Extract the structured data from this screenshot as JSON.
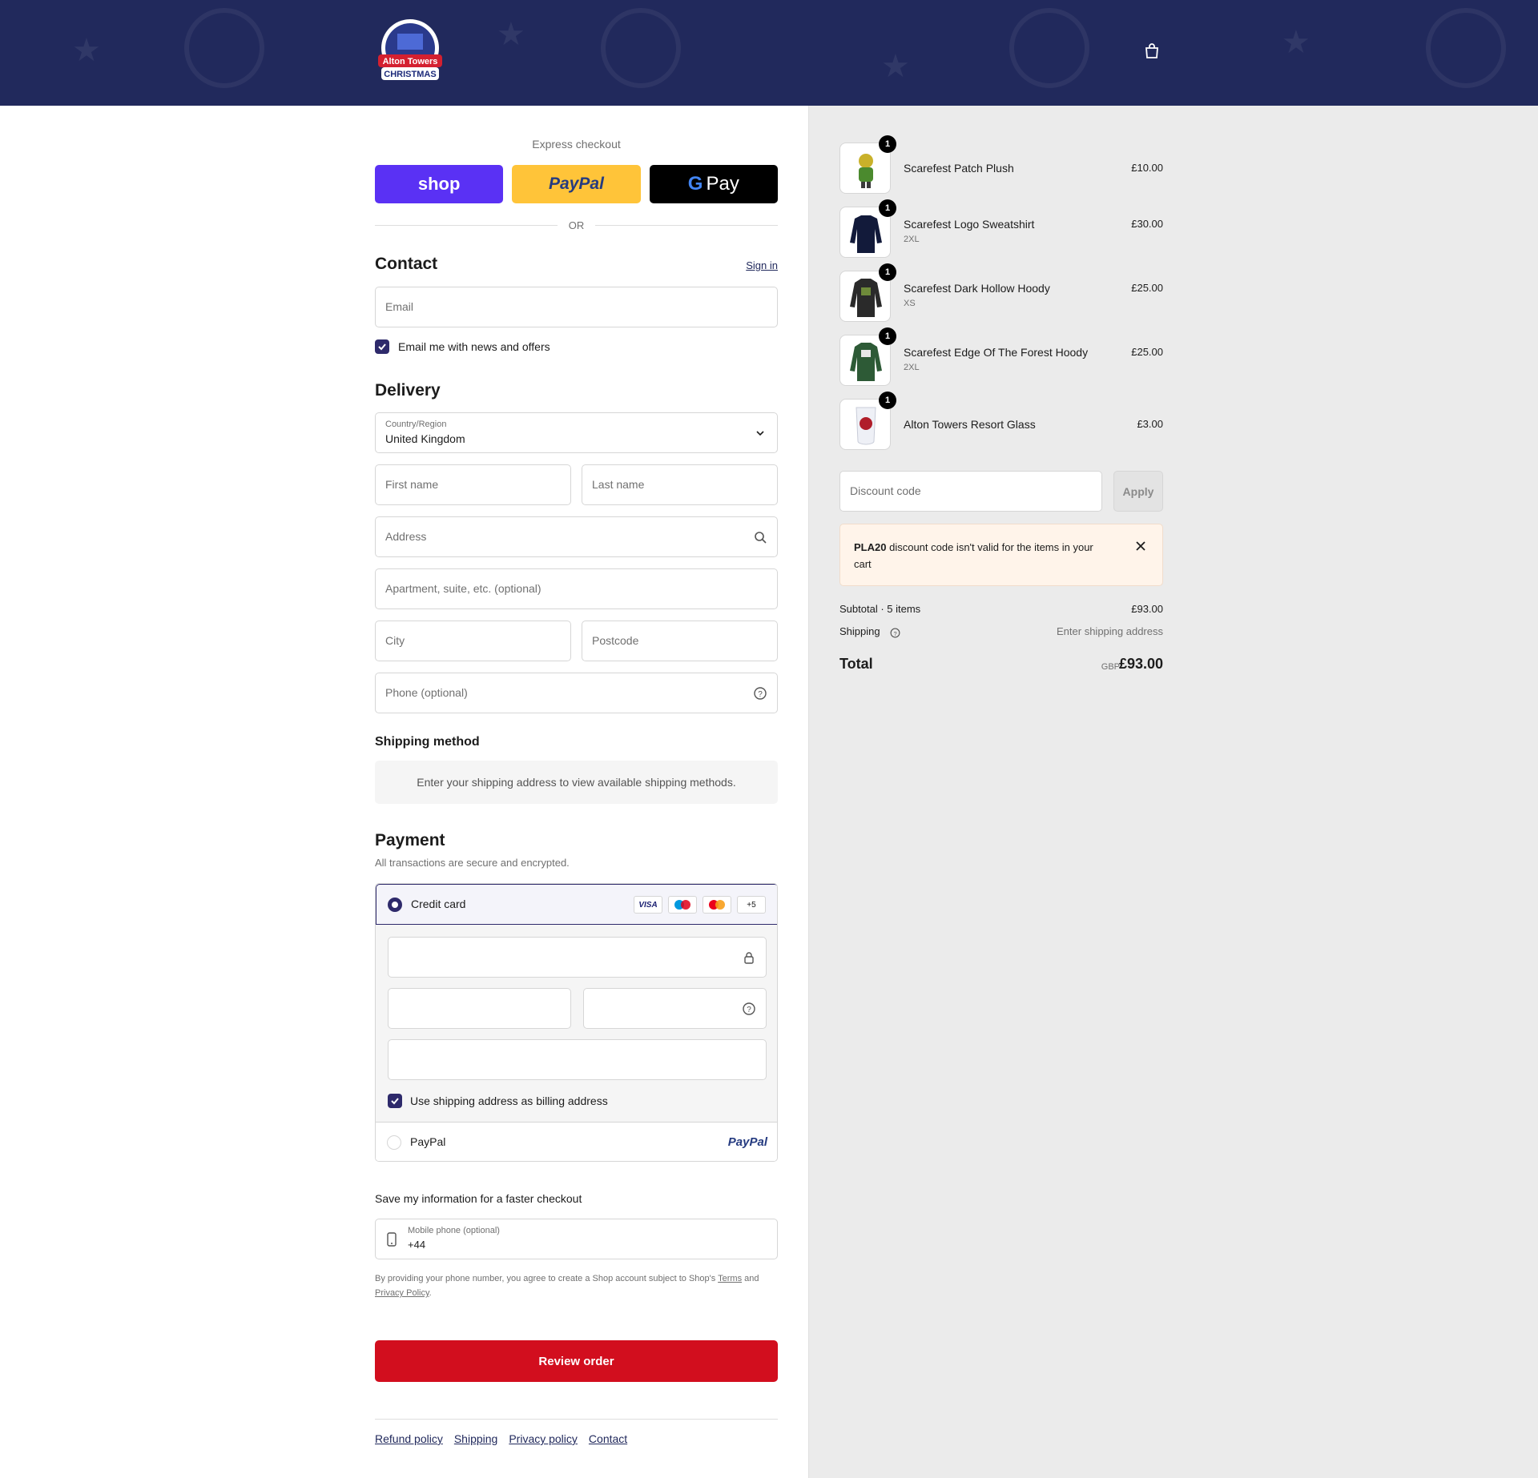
{
  "header": {
    "logo_text": "Alton Towers CHRISTMAS",
    "cart_icon": "bag-icon"
  },
  "express": {
    "label": "Express checkout",
    "shop_label": "shop",
    "paypal_label": "PayPal",
    "gpay_label": "Pay",
    "or_label": "OR"
  },
  "contact": {
    "title": "Contact",
    "sign_in": "Sign in",
    "email_placeholder": "Email",
    "news_label": "Email me with news and offers",
    "news_checked": true
  },
  "delivery": {
    "title": "Delivery",
    "country_label": "Country/Region",
    "country_value": "United Kingdom",
    "first_name": "First name",
    "last_name": "Last name",
    "address": "Address",
    "apartment": "Apartment, suite, etc. (optional)",
    "city": "City",
    "postcode": "Postcode",
    "phone": "Phone (optional)"
  },
  "shipping_method": {
    "title": "Shipping method",
    "notice": "Enter your shipping address to view available shipping methods."
  },
  "payment": {
    "title": "Payment",
    "subtitle": "All transactions are secure and encrypted.",
    "credit_card_label": "Credit card",
    "card_badges": [
      "VISA",
      "maestro",
      "mastercard",
      "+5"
    ],
    "billing_label": "Use shipping address as billing address",
    "paypal_label": "PayPal",
    "paypal_logo": "PayPal"
  },
  "save_info": {
    "title": "Save my information for a faster checkout",
    "mobile_label": "Mobile phone (optional)",
    "mobile_value": "+44",
    "consent_prefix": "By providing your phone number, you agree to create a Shop account subject to Shop's",
    "terms": "Terms",
    "and": "and",
    "privacy": "Privacy Policy",
    "period": "."
  },
  "review_button": "Review order",
  "footer": {
    "links": [
      "Refund policy",
      "Shipping",
      "Privacy policy",
      "Contact"
    ]
  },
  "cart": {
    "items": [
      {
        "name": "Scarefest Patch Plush",
        "variant": "",
        "price": "£10.00",
        "qty": "1"
      },
      {
        "name": "Scarefest Logo Sweatshirt",
        "variant": "2XL",
        "price": "£30.00",
        "qty": "1"
      },
      {
        "name": "Scarefest Dark Hollow Hoody",
        "variant": "XS",
        "price": "£25.00",
        "qty": "1"
      },
      {
        "name": "Scarefest Edge Of The Forest Hoody",
        "variant": "2XL",
        "price": "£25.00",
        "qty": "1"
      },
      {
        "name": "Alton Towers Resort Glass",
        "variant": "",
        "price": "£3.00",
        "qty": "1"
      }
    ],
    "discount_placeholder": "Discount code",
    "apply_label": "Apply",
    "alert_code": "PLA20",
    "alert_text": "discount code isn't valid for the items in your cart",
    "subtotal_label": "Subtotal · 5 items",
    "subtotal_value": "£93.00",
    "shipping_label": "Shipping",
    "shipping_value": "Enter shipping address",
    "total_label": "Total",
    "currency": "GBP",
    "total_value": "£93.00"
  },
  "colors": {
    "header_bg": "#21295c",
    "accent": "#2e2a6b",
    "review_button": "#d20e1e",
    "shop_button": "#5a31f4",
    "paypal_button": "#ffc439"
  }
}
